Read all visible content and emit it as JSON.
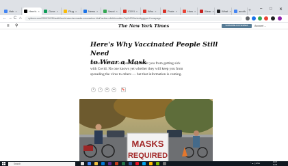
{
  "browser": {
    "tabs": [
      {
        "label": "Hab",
        "favicon": "#4285f4"
      },
      {
        "label": "Here's",
        "favicon": "#000000",
        "active": true
      },
      {
        "label": "Gove",
        "favicon": "#0f9d58"
      },
      {
        "label": "Plug",
        "favicon": "#fbbc05"
      },
      {
        "label": "News",
        "favicon": "#1a73e8"
      },
      {
        "label": "Vacci",
        "favicon": "#34a853"
      },
      {
        "label": "COVI",
        "favicon": "#d93025"
      },
      {
        "label": "Who",
        "favicon": "#d93025"
      },
      {
        "label": "Prote",
        "favicon": "#d93025"
      },
      {
        "label": "How",
        "favicon": "#ea4335"
      },
      {
        "label": "Wear",
        "favicon": "#c5221f"
      },
      {
        "label": "What",
        "favicon": "#202124"
      },
      {
        "label": "anoth",
        "favicon": "#4285f4"
      }
    ],
    "new_tab": "+",
    "window_controls": {
      "minimize": "–",
      "maximize": "□",
      "close": "✕"
    },
    "address": "nytimes.com/2020/11/25/health/covid-vaccine-masks-coronavirus.html?action=click&module=Top%20Stories&pgtype=Homepage",
    "nav": {
      "back": "←",
      "forward": "→",
      "reload": "C",
      "home": "⌂"
    }
  },
  "nyt": {
    "menu_icon": "hamburger-icon",
    "search_icon": "search-icon",
    "logo": "The New York Times",
    "subscribe": "SUBSCRIBE FOR $1/WEEK",
    "account": "Account ⌄"
  },
  "article": {
    "headline_line1": "Here's Why Vaccinated People Still Need",
    "headline_line2": "to Wear a Mask",
    "summary_line1": "The new vaccines will probably prevent you from getting sick",
    "summary_line2": "with Covid. No one knows yet whether they will keep you from",
    "summary_line3": "spreading the virus to others — but that information is coming.",
    "share_icons": [
      "f",
      "t",
      "✉",
      "➦",
      "🔖"
    ],
    "photo_sign_line1": "MASKS",
    "photo_sign_line2": "REQUIRED"
  },
  "taskbar": {
    "search_placeholder": "Search",
    "tray": "^ ☁ ◫ ENG",
    "time": "19:07",
    "date": "11/26"
  }
}
